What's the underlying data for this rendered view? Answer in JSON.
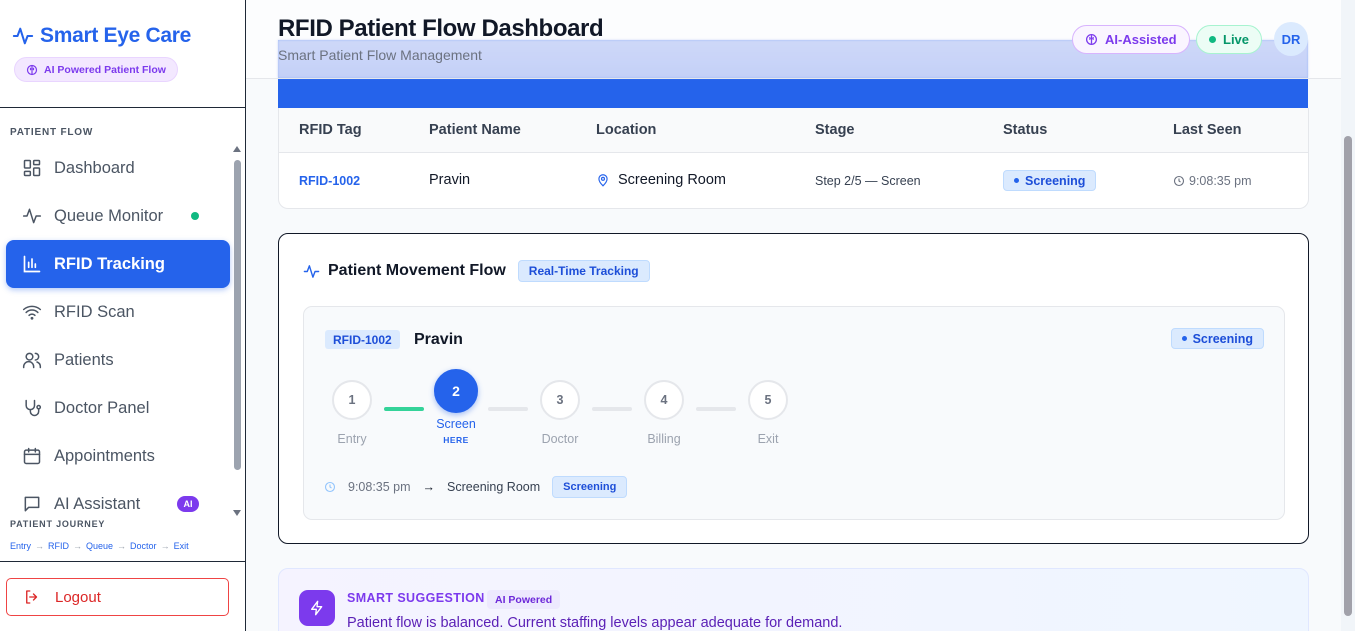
{
  "brand": {
    "title": "Smart Eye Care",
    "pill": "AI Powered Patient Flow"
  },
  "sidebar": {
    "section_label": "PATIENT FLOW",
    "items": [
      {
        "label": "Dashboard",
        "icon": "dashboard-icon"
      },
      {
        "label": "Queue Monitor",
        "icon": "activity-icon"
      },
      {
        "label": "RFID Tracking",
        "icon": "bar-chart-icon"
      },
      {
        "label": "RFID Scan",
        "icon": "wifi-icon"
      },
      {
        "label": "Patients",
        "icon": "users-icon"
      },
      {
        "label": "Doctor Panel",
        "icon": "stethoscope-icon"
      },
      {
        "label": "Appointments",
        "icon": "calendar-icon"
      },
      {
        "label": "AI Assistant",
        "icon": "message-icon",
        "badge": "AI"
      }
    ],
    "journey_label": "PATIENT JOURNEY",
    "journey": [
      "Entry",
      "RFID",
      "Queue",
      "Doctor",
      "Exit"
    ],
    "journey_sep": "→",
    "logout": "Logout"
  },
  "header": {
    "title": "RFID Patient Flow Dashboard",
    "subtitle": "Smart Patient Flow Management",
    "ai_pill": "AI-Assisted",
    "live_pill": "Live",
    "avatar": "DR"
  },
  "table": {
    "columns": [
      "RFID Tag",
      "Patient Name",
      "Location",
      "Stage",
      "Status",
      "Last Seen"
    ],
    "row": {
      "rfid": "RFID-1002",
      "name": "Pravin",
      "location": "Screening Room",
      "stage": "Step 2/5 — Screen",
      "status": "Screening",
      "last_seen": "9:08:35 pm"
    }
  },
  "movement": {
    "title": "Patient Movement Flow",
    "badge": "Real-Time Tracking",
    "tag": "RFID-1002",
    "name": "Pravin",
    "status": "Screening",
    "steps": [
      {
        "num": "1",
        "label": "Entry"
      },
      {
        "num": "2",
        "label": "Screen",
        "here": "HERE"
      },
      {
        "num": "3",
        "label": "Doctor"
      },
      {
        "num": "4",
        "label": "Billing"
      },
      {
        "num": "5",
        "label": "Exit"
      }
    ],
    "current_step": 2,
    "log": {
      "time": "9:08:35 pm",
      "arrow": "→",
      "location": "Screening Room",
      "status": "Screening"
    }
  },
  "suggestion": {
    "title": "SMART SUGGESTION",
    "badge": "AI Powered",
    "text": "Patient flow is balanced. Current staffing levels appear adequate for demand."
  },
  "colors": {
    "primary": "#2563eb",
    "purple": "#7c3aed",
    "green": "#10b981",
    "danger": "#dc2626"
  }
}
